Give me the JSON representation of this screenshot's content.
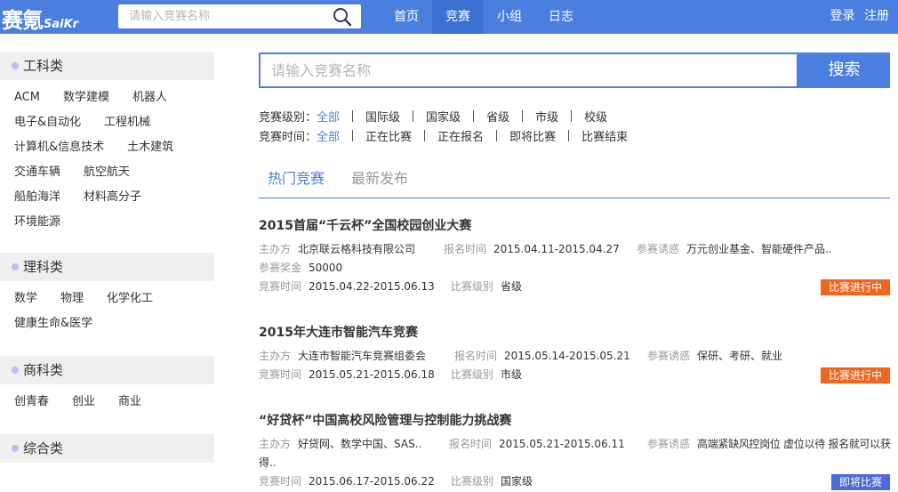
{
  "header": {
    "logo_text": "赛氪",
    "logo_sub": "SaiKr",
    "search_placeholder": "请输入竞赛名称",
    "nav": [
      "首页",
      "竞赛",
      "小组",
      "日志"
    ],
    "login": "登录",
    "register": "注册"
  },
  "sidebar": {
    "categories": [
      {
        "title": "工科类",
        "items": [
          "ACM",
          "数学建模",
          "机器人",
          "电子&自动化",
          "工程机械",
          "计算机&信息技术",
          "土木建筑",
          "交通车辆",
          "航空航天",
          "船舶海洋",
          "材料高分子",
          "环境能源"
        ]
      },
      {
        "title": "理科类",
        "items": [
          "数学",
          "物理",
          "化学化工",
          "健康生命&医学"
        ]
      },
      {
        "title": "商科类",
        "items": [
          "创青春",
          "创业",
          "商业"
        ]
      },
      {
        "title": "综合类",
        "items": []
      }
    ]
  },
  "main": {
    "search_placeholder": "请输入竞赛名称",
    "search_button": "搜索",
    "filter_level": {
      "label": "竞赛级别：",
      "options": [
        "全部",
        "国际级",
        "国家级",
        "省级",
        "市级",
        "校级"
      ],
      "selected": "全部"
    },
    "filter_time": {
      "label": "竞赛时间：",
      "options": [
        "全部",
        "正在比赛",
        "正在报名",
        "即将比赛",
        "比赛结束"
      ],
      "selected": "全部"
    },
    "tabs": [
      "热门竞赛",
      "最新发布"
    ],
    "labels": {
      "organizer": "主办方",
      "signup": "报名时间",
      "reward": "参赛诱惑",
      "prize": "参赛奖金",
      "time": "竞赛时间",
      "level": "比赛级别"
    },
    "competitions": [
      {
        "title": "2015首届“千云杯”全国校园创业大赛",
        "organizer": "北京联云格科技有限公司",
        "signup": "2015.04.11-2015.04.27",
        "reward": "万元创业基金、智能硬件产品..",
        "prize": "50000",
        "time": "2015.04.22-2015.06.13",
        "level": "省级",
        "status": "比赛进行中"
      },
      {
        "title": "2015年大连市智能汽车竞赛",
        "organizer": "大连市智能汽车竞赛组委会",
        "signup": "2015.05.14-2015.05.21",
        "reward": "保研、考研、就业",
        "time": "2015.05.21-2015.06.18",
        "level": "市级",
        "status": "比赛进行中"
      },
      {
        "title": "“好贷杯”中国高校风险管理与控制能力挑战赛",
        "organizer": "好贷网、数学中国、SAS..",
        "signup": "2015.05.21-2015.06.11",
        "reward": "高端紧缺风控岗位 虚位以待 报名就可以获",
        "reward_cont": "得..",
        "time": "2015.06.17-2015.06.22",
        "level": "国家级",
        "status": "即将比赛"
      }
    ]
  },
  "colors": {
    "primary": "#4a7fe0",
    "nav_active": "#3b6fd0",
    "badge_running": "#f0661e",
    "badge_upcoming": "#4a6ad8"
  }
}
